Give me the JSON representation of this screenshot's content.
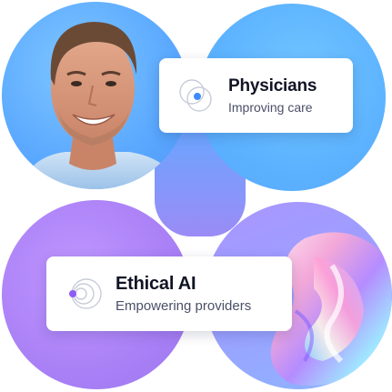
{
  "cards": {
    "physicians": {
      "title": "Physicians",
      "subtitle": "Improving care"
    },
    "ethical_ai": {
      "title": "Ethical AI",
      "subtitle": "Empowering providers"
    }
  },
  "colors": {
    "accent_blue": "#3d8bfd",
    "accent_purple": "#8f5cf7",
    "circle_blue": "#5aa8ff",
    "circle_purple": "#aa80f6"
  },
  "images": {
    "portrait": "smiling-man-portrait",
    "abstract": "iridescent-fluid-shape"
  }
}
